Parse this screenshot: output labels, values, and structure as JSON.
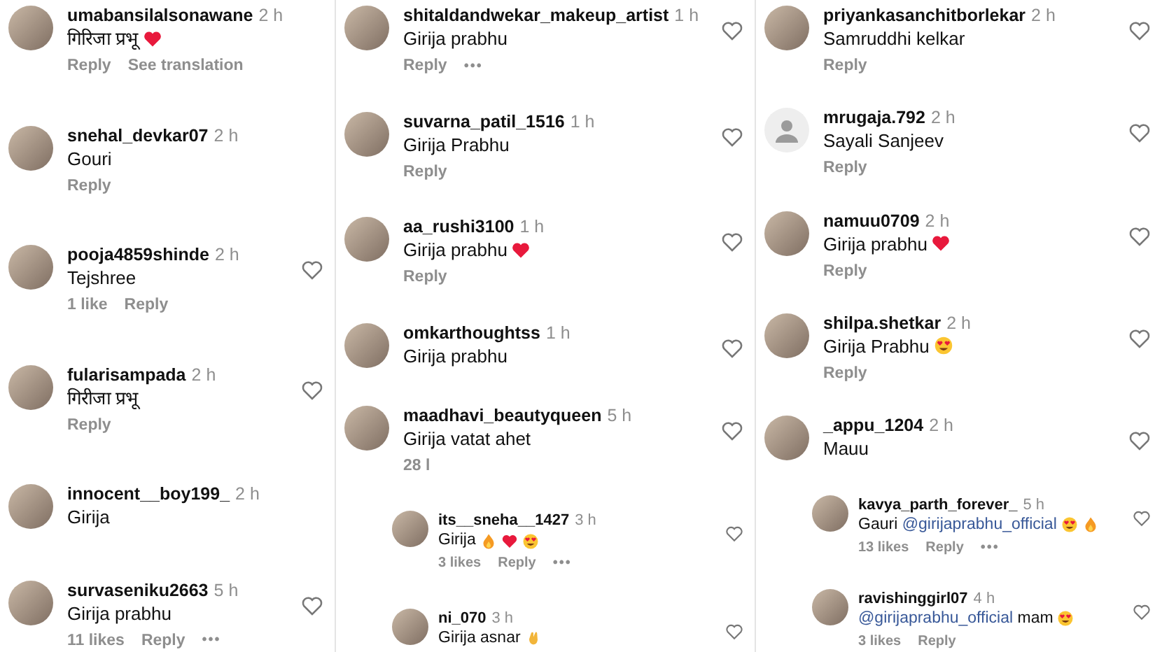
{
  "columns": [
    {
      "comments": [
        {
          "default_avatar": false,
          "username": "umabansilalsonawane",
          "time": "2 h",
          "text": "गिरिजा प्रभू",
          "emojis": [
            {
              "kind": "heart"
            }
          ],
          "like_button": false,
          "actions": [
            "Reply",
            "See translation"
          ]
        },
        {
          "default_avatar": false,
          "username": "snehal_devkar07",
          "time": "2 h",
          "text": "Gouri",
          "like_button": false,
          "actions": [
            "Reply"
          ]
        },
        {
          "default_avatar": false,
          "username": "pooja4859shinde",
          "time": "2 h",
          "text": "Tejshree",
          "like_button": true,
          "likes": "1 like",
          "actions": [
            "Reply"
          ]
        },
        {
          "default_avatar": false,
          "username": "fularisampada",
          "time": "2 h",
          "text": "गिरीजा प्रभू",
          "like_button": true,
          "actions": [
            "Reply"
          ]
        },
        {
          "default_avatar": false,
          "username": "innocent__boy199_",
          "time": "2 h",
          "text": "Girija",
          "like_button": false
        },
        {
          "default_avatar": false,
          "username": "survaseniku2663",
          "time": "5 h",
          "text": "Girija prabhu",
          "like_button": true,
          "likes": "11 likes",
          "actions": [
            "Reply"
          ],
          "more": "•••"
        }
      ]
    },
    {
      "comments": [
        {
          "default_avatar": false,
          "username": "shitaldandwekar_makeup_artist",
          "time": "1 h",
          "text": "Girija prabhu",
          "like_button": true,
          "actions": [
            "Reply"
          ],
          "more": "•••"
        },
        {
          "default_avatar": false,
          "username": "suvarna_patil_1516",
          "time": "1 h",
          "text": "Girija Prabhu",
          "like_button": true,
          "actions": [
            "Reply"
          ]
        },
        {
          "default_avatar": false,
          "username": "aa_rushi3100",
          "time": "1 h",
          "text": "Girija prabhu",
          "emojis": [
            {
              "kind": "heart"
            }
          ],
          "like_button": true,
          "actions": [
            "Reply"
          ]
        },
        {
          "default_avatar": false,
          "username": "omkarthoughtss",
          "time": "1 h",
          "text": "Girija prabhu",
          "like_button": true
        },
        {
          "default_avatar": false,
          "username": "maadhavi_beautyqueen",
          "time": "5 h",
          "text": "Girija vatat ahet",
          "like_button": true,
          "likes": "28 l",
          "replies": [
            {
              "default_avatar": false,
              "username": "its__sneha__1427",
              "time": "3 h",
              "text": "Girija",
              "emojis": [
                {
                  "kind": "fire"
                },
                {
                  "kind": "heart"
                },
                {
                  "kind": "heart-eyes"
                }
              ],
              "like_button": true,
              "likes": "3 likes",
              "actions": [
                "Reply"
              ],
              "more": "•••"
            },
            {
              "default_avatar": false,
              "username": "ni_070",
              "time": "3 h",
              "text": "Girija asnar",
              "emojis": [
                {
                  "kind": "clap"
                }
              ],
              "like_button": true
            }
          ]
        }
      ]
    },
    {
      "comments": [
        {
          "default_avatar": false,
          "username": "priyankasanchitborlekar",
          "time": "2 h",
          "text": "Samruddhi kelkar",
          "like_button": true,
          "actions": [
            "Reply"
          ]
        },
        {
          "default_avatar": true,
          "username": "mrugaja.792",
          "time": "2 h",
          "text": "Sayali Sanjeev",
          "like_button": true,
          "actions": [
            "Reply"
          ]
        },
        {
          "default_avatar": false,
          "username": "namuu0709",
          "time": "2 h",
          "text": "Girija prabhu",
          "emojis": [
            {
              "kind": "heart"
            }
          ],
          "like_button": true,
          "actions": [
            "Reply"
          ]
        },
        {
          "default_avatar": false,
          "username": "shilpa.shetkar",
          "time": "2 h",
          "text": "Girija Prabhu",
          "emojis": [
            {
              "kind": "heart-eyes"
            }
          ],
          "like_button": true,
          "actions": [
            "Reply"
          ]
        },
        {
          "default_avatar": false,
          "username": "_appu_1204",
          "time": "2 h",
          "text": "Mauu",
          "like_button": true,
          "replies": [
            {
              "default_avatar": false,
              "username": "kavya_parth_forever_",
              "time": "5 h",
              "text": "Gauri",
              "mention_after": "@girijaprabhu_official",
              "emojis": [
                {
                  "kind": "heart-eyes"
                },
                {
                  "kind": "fire"
                }
              ],
              "like_button": true,
              "likes": "13 likes",
              "actions": [
                "Reply"
              ],
              "more": "•••"
            },
            {
              "default_avatar": false,
              "username": "ravishinggirl07",
              "time": "4 h",
              "mention_before": "@girijaprabhu_official",
              "text": "mam",
              "emojis": [
                {
                  "kind": "heart-eyes"
                }
              ],
              "like_button": true,
              "likes": "3 likes",
              "actions": [
                "Reply"
              ]
            }
          ]
        }
      ]
    }
  ]
}
